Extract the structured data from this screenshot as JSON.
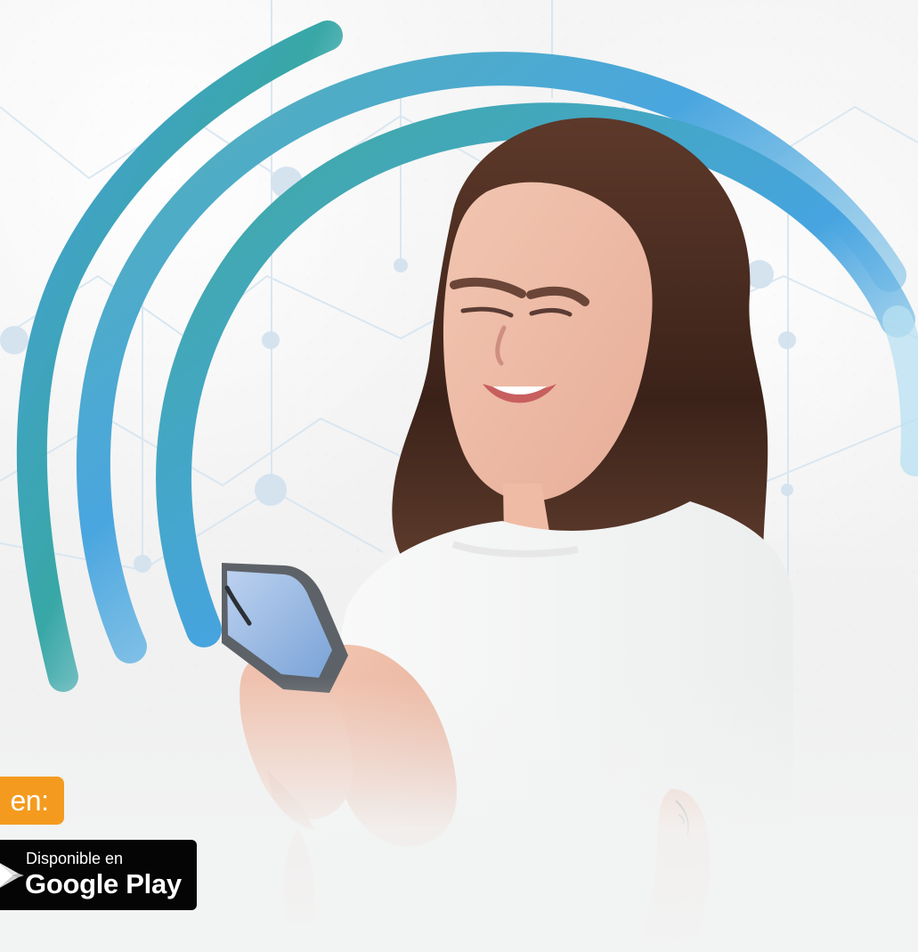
{
  "promo": {
    "badge_text": "en:",
    "store_top": "Disponible en",
    "store_name": "Google Play"
  },
  "icons": {
    "store": "google-play-icon"
  },
  "colors": {
    "badge": "#f49b1f",
    "button": "#050505",
    "arc_start": "#3aa7a3",
    "arc_end": "#4aa6df"
  }
}
